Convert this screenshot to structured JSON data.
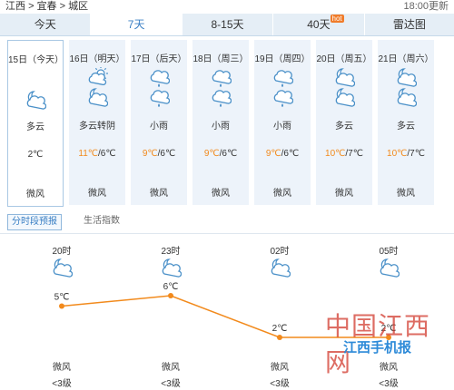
{
  "breadcrumb": {
    "province": "江西",
    "sep1": ">",
    "city": "宜春",
    "sep2": ">",
    "district": "城区"
  },
  "updated": "18:00更新",
  "tabs": [
    {
      "label": "今天"
    },
    {
      "label": "7天"
    },
    {
      "label": "8-15天"
    },
    {
      "label": "40天",
      "badge": "hot"
    },
    {
      "label": "雷达图"
    }
  ],
  "days": [
    {
      "date": "15日（今天）",
      "icon": "cloudy-icon",
      "desc": "多云",
      "temp_high": "",
      "temp_low": "2℃",
      "wind": "微风"
    },
    {
      "date": "16日（明天）",
      "icon": "cloudy-to-sunny-icon",
      "desc": "多云转阴",
      "temp_high": "11℃",
      "temp_low": "6℃",
      "wind": "微风"
    },
    {
      "date": "17日（后天）",
      "icon": "light-rain-icon",
      "desc": "小雨",
      "temp_high": "9℃",
      "temp_low": "6℃",
      "wind": "微风"
    },
    {
      "date": "18日（周三）",
      "icon": "light-rain-icon",
      "desc": "小雨",
      "temp_high": "9℃",
      "temp_low": "6℃",
      "wind": "微风"
    },
    {
      "date": "19日（周四）",
      "icon": "light-rain-icon",
      "desc": "小雨",
      "temp_high": "9℃",
      "temp_low": "6℃",
      "wind": "微风"
    },
    {
      "date": "20日（周五）",
      "icon": "cloudy-icon",
      "desc": "多云",
      "temp_high": "10℃",
      "temp_low": "7℃",
      "wind": "微风"
    },
    {
      "date": "21日（周六）",
      "icon": "cloudy-icon",
      "desc": "多云",
      "temp_high": "10℃",
      "temp_low": "7℃",
      "wind": "微风"
    }
  ],
  "subtabs": [
    {
      "label": "分时段预报"
    },
    {
      "label": "生活指数"
    }
  ],
  "hourly": [
    {
      "time": "20时",
      "icon": "cloudy-night-icon",
      "temp": "5℃",
      "wind": "微风",
      "level": "<3级"
    },
    {
      "time": "23时",
      "icon": "cloudy-night-icon",
      "temp": "6℃",
      "wind": "微风",
      "level": "<3级"
    },
    {
      "time": "02时",
      "icon": "cloudy-night-icon",
      "temp": "2℃",
      "wind": "微风",
      "level": "<3级"
    },
    {
      "time": "05时",
      "icon": "cloudy-night-icon",
      "temp": "2℃",
      "wind": "微风",
      "level": "<3级"
    }
  ],
  "watermark": {
    "line1": "中国江西网",
    "line2": "江西手机报"
  },
  "colors": {
    "accent": "#3a7fc4",
    "high_temp": "#f28a1c",
    "line": "#f28a1c",
    "icon": "#4a90c8"
  }
}
